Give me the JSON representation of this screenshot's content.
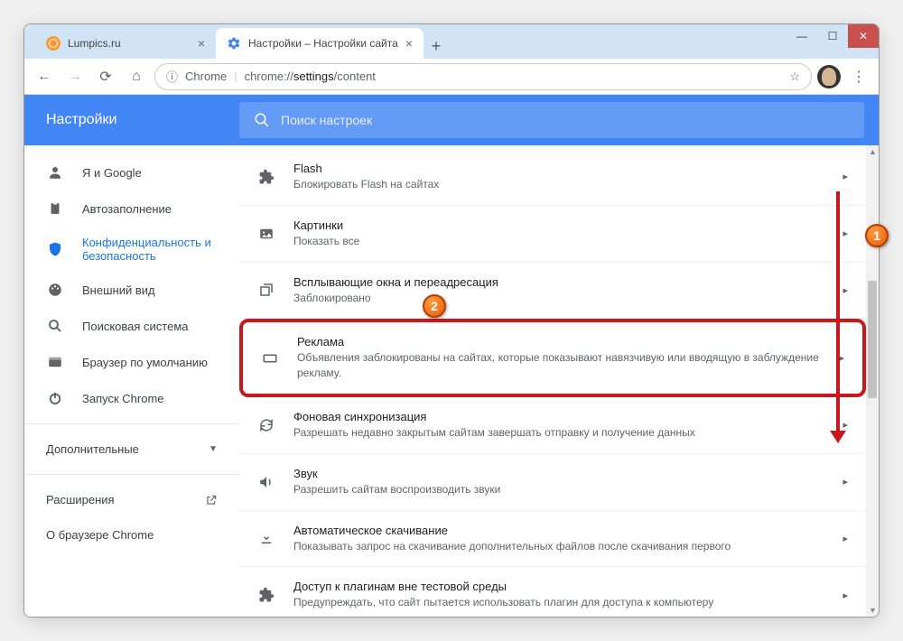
{
  "tabs": [
    {
      "title": "Lumpics.ru",
      "favicon": "lumpics"
    },
    {
      "title": "Настройки – Настройки сайта",
      "favicon": "gear"
    }
  ],
  "omnibox": {
    "chrome_label": "Chrome",
    "url": "chrome://settings/content",
    "url_prefix": "chrome://",
    "url_bold": "settings",
    "url_suffix": "/content"
  },
  "header": {
    "title": "Настройки",
    "search_placeholder": "Поиск настроек"
  },
  "sidebar": {
    "items": [
      {
        "label": "Я и Google"
      },
      {
        "label": "Автозаполнение"
      },
      {
        "label": "Конфиденциальность и безопасность"
      },
      {
        "label": "Внешний вид"
      },
      {
        "label": "Поисковая система"
      },
      {
        "label": "Браузер по умолчанию"
      },
      {
        "label": "Запуск Chrome"
      }
    ],
    "advanced": "Дополнительные",
    "extensions": "Расширения",
    "about": "О браузере Chrome"
  },
  "settings": [
    {
      "title": "Flash",
      "sub": "Блокировать Flash на сайтах"
    },
    {
      "title": "Картинки",
      "sub": "Показать все"
    },
    {
      "title": "Всплывающие окна и переадресация",
      "sub": "Заблокировано"
    },
    {
      "title": "Реклама",
      "sub": "Объявления заблокированы на сайтах, которые показывают навязчивую или вводящую в заблуждение рекламу."
    },
    {
      "title": "Фоновая синхронизация",
      "sub": "Разрешать недавно закрытым сайтам завершать отправку и получение данных"
    },
    {
      "title": "Звук",
      "sub": "Разрешить сайтам воспроизводить звуки"
    },
    {
      "title": "Автоматическое скачивание",
      "sub": "Показывать запрос на скачивание дополнительных файлов после скачивания первого"
    },
    {
      "title": "Доступ к плагинам вне тестовой среды",
      "sub": "Предупреждать, что сайт пытается использовать плагин для доступа к компьютеру"
    }
  ],
  "annotations": {
    "a1": "1",
    "a2": "2"
  }
}
